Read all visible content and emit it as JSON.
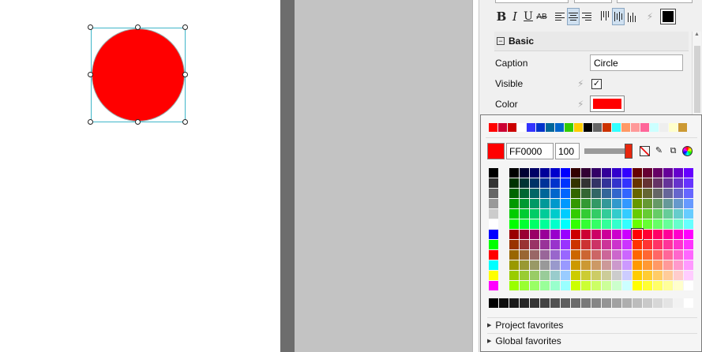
{
  "panel": {
    "section_title": "Basic",
    "collapse_glyph": "−",
    "bolt_glyph": "⚡",
    "caption_label": "Caption",
    "caption_value": "Circle",
    "visible_label": "Visible",
    "visible_checked": "✓",
    "color_label": "Color",
    "color_value": "#ff0000"
  },
  "toolbar": {
    "bold": "B",
    "italic": "I",
    "underline": "U",
    "strike": "AB",
    "text_color": "#000000"
  },
  "picker": {
    "current_color": "#ff0000",
    "hex_value": "FF0000",
    "alpha_value": "100",
    "alpha_level": 1.0,
    "copy_glyph": "⧉",
    "eyedropper_glyph": "✎",
    "recent_colors": [
      "#ff0000",
      "#cc0033",
      "#cc0000",
      "#ffffff",
      "#3333ff",
      "#0033cc",
      "#006699",
      "#0066cc",
      "#33cc00",
      "#ffcc00",
      "#000000",
      "#666666",
      "#cc3300",
      "#33ffff",
      "#ff9966",
      "#ff9999",
      "#ff6699",
      "#ccffff",
      "#eeeeee",
      "#ffffcc",
      "#cc9933"
    ],
    "side_colors": [
      "#000000",
      "#333333",
      "#666666",
      "#999999",
      "#cccccc",
      "#ffffff",
      "#0000ff",
      "#00ff00",
      "#ff0000",
      "#00ffff",
      "#ffff00",
      "#ff00ff"
    ],
    "selected_color": "#ff0000",
    "project_favorites": "Project favorites",
    "global_favorites": "Global favorites",
    "tri_glyph": "▶"
  }
}
